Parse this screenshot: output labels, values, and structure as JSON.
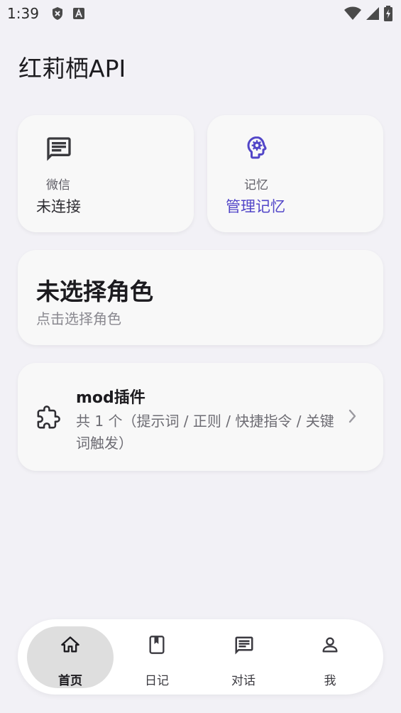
{
  "status_bar": {
    "time": "1:39",
    "left_icons": [
      "shield-icon",
      "font-a-icon"
    ],
    "right_icons": [
      "wifi-icon",
      "signal-icon",
      "battery-charging-icon"
    ]
  },
  "header": {
    "title": "红莉栖API"
  },
  "wechat_card": {
    "label": "微信",
    "value": "未连接",
    "icon": "message-icon",
    "value_color": "#2f2e33"
  },
  "memory_card": {
    "label": "记忆",
    "value": "管理记忆",
    "icon": "brain-gear-icon",
    "value_color": "#5246c8"
  },
  "role_card": {
    "title": "未选择角色",
    "subtitle": "点击选择角色"
  },
  "mod_card": {
    "title": "mod插件",
    "description": "共 1 个（提示词 / 正则 / 快捷指令 / 关键词触发）",
    "icon": "puzzle-icon",
    "chevron": "chevron-right-icon"
  },
  "bottom_nav": {
    "items": [
      {
        "label": "首页",
        "icon": "home-icon",
        "active": true
      },
      {
        "label": "日记",
        "icon": "book-icon",
        "active": false
      },
      {
        "label": "对话",
        "icon": "chat-icon",
        "active": false
      },
      {
        "label": "我",
        "icon": "person-icon",
        "active": false
      }
    ]
  },
  "colors": {
    "accent": "#5246c8",
    "background": "#f2f1f6",
    "card": "#f8f8f8"
  }
}
